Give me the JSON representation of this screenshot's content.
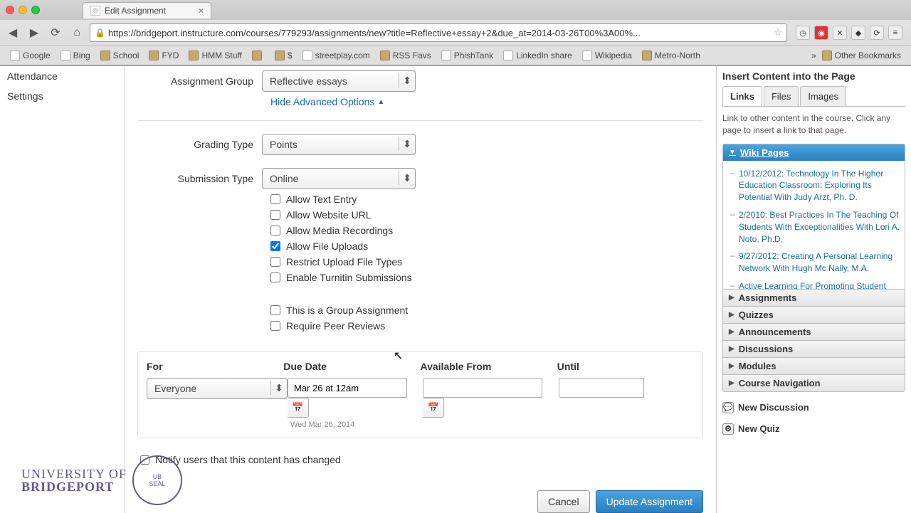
{
  "browser": {
    "tab_title": "Edit Assignment",
    "url": "https://bridgeport.instructure.com/courses/779293/assignments/new?title=Reflective+essay+2&due_at=2014-03-26T00%3A00%...",
    "bookmarks": [
      "Google",
      "Bing",
      "School",
      "FYD",
      "HMM Stuff",
      "",
      "$",
      "streetplay.com",
      "RSS Favs",
      "PhishTank",
      "LinkedIn share",
      "Wikipedia",
      "Metro-North"
    ],
    "other_bookmarks": "Other Bookmarks"
  },
  "left_nav": {
    "items": [
      "Attendance",
      "Settings"
    ]
  },
  "form": {
    "assignment_group_label": "Assignment Group",
    "assignment_group_value": "Reflective essays",
    "hide_adv": "Hide Advanced Options",
    "grading_type_label": "Grading Type",
    "grading_type_value": "Points",
    "submission_type_label": "Submission Type",
    "submission_type_value": "Online",
    "opts": {
      "text_entry": "Allow Text Entry",
      "website_url": "Allow Website URL",
      "media_rec": "Allow Media Recordings",
      "file_uploads": "Allow File Uploads",
      "restrict_types": "Restrict Upload File Types",
      "turnitin": "Enable Turnitin Submissions",
      "group_assign": "This is a Group Assignment",
      "peer_reviews": "Require Peer Reviews"
    },
    "due": {
      "for_label": "For",
      "for_value": "Everyone",
      "due_label": "Due Date",
      "due_value": "Mar 26 at 12am",
      "due_helper": "Wed Mar 26, 2014",
      "avail_label": "Available From",
      "until_label": "Until"
    },
    "notify": "Notify users that this content has changed",
    "cancel": "Cancel",
    "update": "Update Assignment"
  },
  "right": {
    "title": "Insert Content into the Page",
    "tabs": [
      "Links",
      "Files",
      "Images"
    ],
    "help": "Link to other content in the course. Click any page to insert a link to that page.",
    "wiki_header": "Wiki Pages",
    "wiki_items": [
      "10/12/2012: Technology In The Higher Education Classroom: Exploring Its Potential With Judy Arzt, Ph. D.",
      "2/2010: Best Practices In The Teaching Of Students With Exceptionalities With Lori A. Noto, Ph.D.",
      "9/27/2012: Creating A Personal Learning Network With Hugh Mc Nally, M.A.",
      "Active Learning For Promoting Student"
    ],
    "sections": [
      "Assignments",
      "Quizzes",
      "Announcements",
      "Discussions",
      "Modules",
      "Course Navigation"
    ],
    "new_discussion": "New Discussion",
    "new_quiz": "New Quiz"
  },
  "watermark": {
    "line1": "UNIVERSITY OF",
    "line2": "BRIDGEPORT"
  }
}
